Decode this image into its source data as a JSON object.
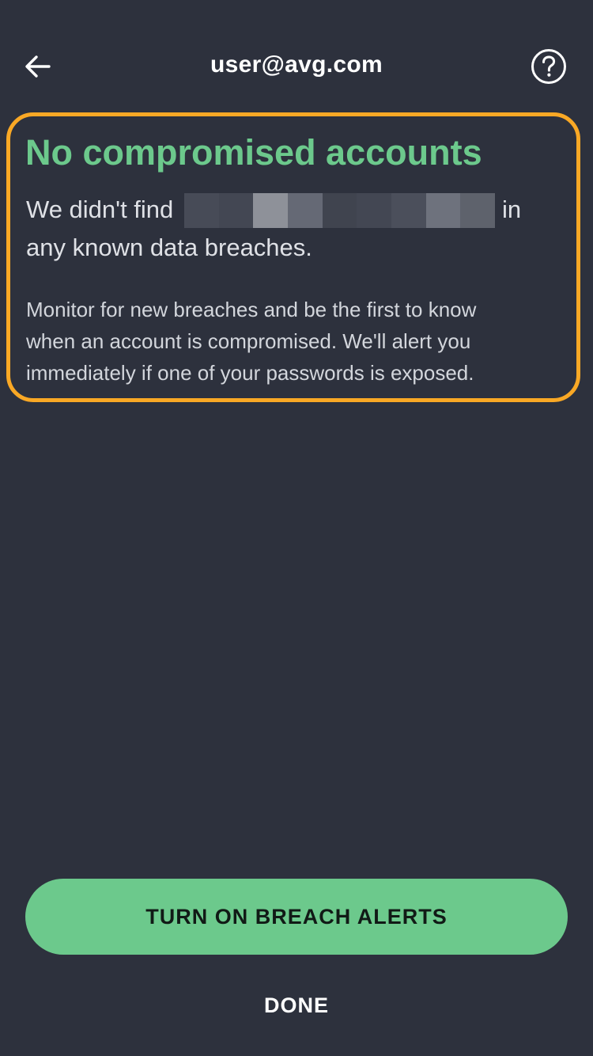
{
  "header": {
    "title": "user@avg.com",
    "back_icon": "arrow-left-icon",
    "help_icon": "question-circle-icon"
  },
  "result": {
    "heading": "No compromised accounts",
    "intro_prefix": "We didn't find",
    "intro_suffix": "in",
    "intro_line2": "any known data breaches.",
    "description_lines": [
      "Monitor for new breaches and be the first to know",
      "when an account is compromised. We'll alert you",
      "immediately if one of your passwords is exposed."
    ]
  },
  "actions": {
    "primary_label": "TURN ON BREACH ALERTS",
    "secondary_label": "DONE"
  },
  "colors": {
    "background": "#2d313d",
    "accent_green": "#6cc98c",
    "highlight_orange": "#f9a825"
  }
}
